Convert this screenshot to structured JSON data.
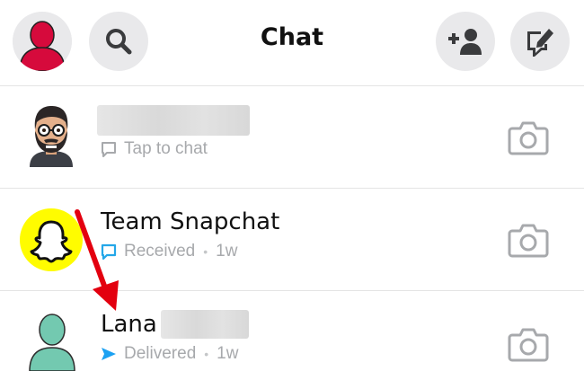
{
  "header": {
    "title": "Chat",
    "left_buttons": [
      "profile-avatar",
      "search-icon"
    ],
    "right_buttons": [
      "add-friend-icon",
      "new-chat-icon"
    ]
  },
  "chats": [
    {
      "name": "",
      "status_icon": "chat-bubble-outline-icon",
      "status": "Tap to chat",
      "time": ""
    },
    {
      "name": "Team Snapchat",
      "status_icon": "received-outline-icon",
      "status": "Received",
      "time": "1w"
    },
    {
      "name": "Lana",
      "status_icon": "sent-arrow-icon",
      "status": "Delivered",
      "time": "1w"
    }
  ],
  "separator": "•",
  "colors": {
    "profile_red": "#d60a3c",
    "snapchat_yellow": "#fffc00",
    "lana_teal": "#73c9b0",
    "delivered_blue": "#1ca1f2",
    "received_blue": "#24a7e8",
    "annotation_red": "#e3000f"
  }
}
